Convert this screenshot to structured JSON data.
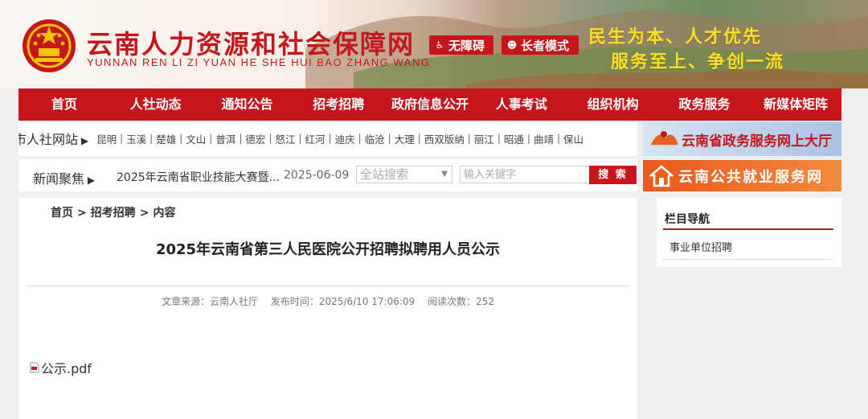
{
  "header": {
    "site_title": "云南人力资源和社会保障网",
    "site_subtitle": "YUNNAN REN LI ZI YUAN HE SHE HUI BAO ZHANG WANG",
    "accessibility_label": "无障碍",
    "elder_mode_label": "长者模式",
    "slogan_line1": "民生为本、人才优先",
    "slogan_line2": "服务至上、争创一流",
    "brand_color": "#c4161c",
    "slogan_color": "#f7df2a"
  },
  "nav": {
    "items": [
      "首页",
      "人社动态",
      "通知公告",
      "招考招聘",
      "政府信息公开",
      "人事考试",
      "组织机构",
      "政务服务",
      "新媒体矩阵"
    ]
  },
  "cities": {
    "label": "州市人社网站",
    "items": [
      "昆明",
      "玉溪",
      "楚雄",
      "文山",
      "普洱",
      "德宏",
      "怒江",
      "红河",
      "迪庆",
      "临沧",
      "大理",
      "西双版纳",
      "丽江",
      "昭通",
      "曲靖",
      "保山"
    ]
  },
  "news": {
    "label": "新闻聚焦",
    "title": "2025年云南省职业技能大赛暨...",
    "date": "2025-06-09"
  },
  "search": {
    "scope": "全站搜索",
    "placeholder": "输入关键字",
    "button_label": "搜 索"
  },
  "banners": {
    "gov_service": "云南省政务服务网上大厅",
    "public_employment": "云南公共就业服务网"
  },
  "breadcrumb": [
    "首页",
    "招考招聘",
    "内容"
  ],
  "article": {
    "title": "2025年云南省第三人民医院公开招聘拟聘用人员公示",
    "source": "文章来源：云南人社厅",
    "publish_time": "发布时间：2025/6/10 17:06:09",
    "views": "阅读次数：252",
    "attachment": "公示.pdf"
  },
  "sidebar": {
    "heading": "栏目导航",
    "items": [
      "事业单位招聘"
    ]
  }
}
